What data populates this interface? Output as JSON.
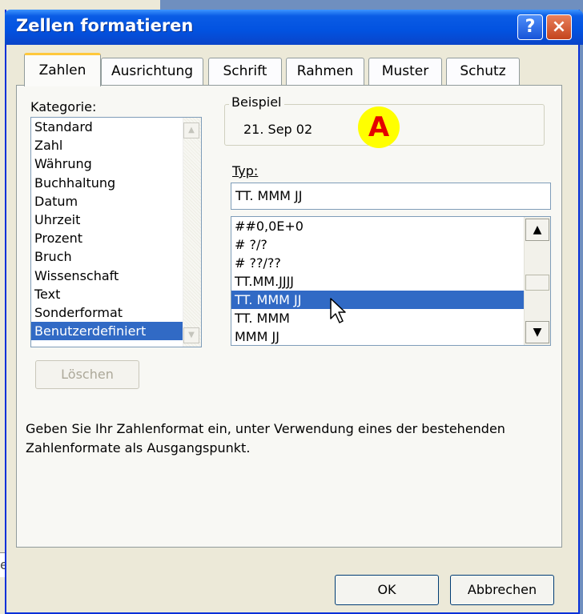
{
  "background": {
    "left_cut_text": "el"
  },
  "window": {
    "title": "Zellen formatieren",
    "help_label": "?",
    "close_label": "×"
  },
  "tabs": [
    {
      "label": "Zahlen",
      "active": true
    },
    {
      "label": "Ausrichtung"
    },
    {
      "label": "Schrift"
    },
    {
      "label": "Rahmen"
    },
    {
      "label": "Muster"
    },
    {
      "label": "Schutz"
    }
  ],
  "kategorie": {
    "label": "Kategorie:",
    "items": [
      "Standard",
      "Zahl",
      "Währung",
      "Buchhaltung",
      "Datum",
      "Uhrzeit",
      "Prozent",
      "Bruch",
      "Wissenschaft",
      "Text",
      "Sonderformat",
      "Benutzerdefiniert"
    ],
    "selected": "Benutzerdefiniert"
  },
  "loeschen_label": "Löschen",
  "beispiel": {
    "label": "Beispiel",
    "value": "21. Sep 02"
  },
  "marker_label": "A",
  "typ": {
    "label": "Typ:",
    "value": "TT. MMM JJ",
    "items": [
      "##0,0E+0",
      "# ?/?",
      "# ??/??",
      "TT.MM.JJJJ",
      "TT. MMM JJ",
      "TT. MMM",
      "MMM JJ"
    ],
    "selected": "TT. MMM JJ"
  },
  "description": "Geben Sie Ihr Zahlenformat ein, unter Verwendung eines der bestehenden Zahlenformate als Ausgangspunkt.",
  "buttons": {
    "ok": "OK",
    "cancel": "Abbrechen"
  }
}
